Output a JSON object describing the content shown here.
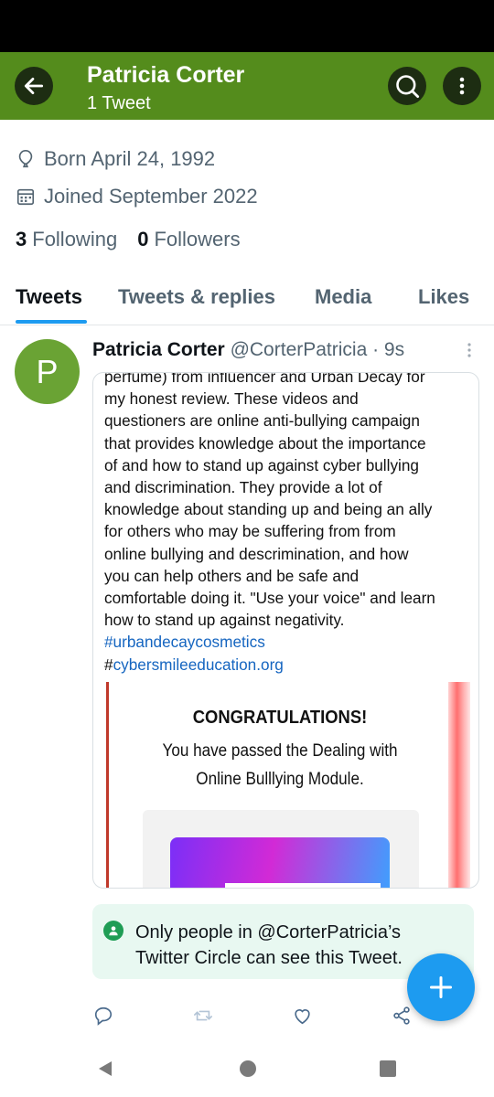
{
  "header": {
    "title": "Patricia Corter",
    "subtitle": "1 Tweet",
    "back_icon": "arrow-left-icon",
    "search_icon": "search-icon",
    "more_icon": "more-vertical-icon"
  },
  "profile": {
    "born": "Born April 24, 1992",
    "joined": "Joined September 2022",
    "following_count": "3",
    "following_label": "Following",
    "followers_count": "0",
    "followers_label": "Followers"
  },
  "tabs": [
    {
      "label": "Tweets",
      "active": true
    },
    {
      "label": "Tweets & replies",
      "active": false
    },
    {
      "label": "Media",
      "active": false
    },
    {
      "label": "Likes",
      "active": false
    }
  ],
  "tweet": {
    "avatar_letter": "P",
    "author_name": "Patricia Corter",
    "author_handle": "@CorterPatricia",
    "time": "· 9s",
    "text_lines": [
      "perfume) from influencer and Urban Decay for",
      "my honest review. These videos and",
      "questioners are online anti-bullying campaign",
      "that provides knowledge about the importance",
      "of and how to stand up against cyber bullying",
      "and discrimination. They provide a lot of",
      "knowledge about standing up and being an ally",
      "for others who may be suffering from from",
      "online bullying and descrimination, and how",
      "you can help others and be safe and",
      "comfortable doing it. \"Use your voice\" and learn",
      "how to stand up against negativity."
    ],
    "hashtag1": "#urbandecaycosmetics",
    "hashtag2_prefix": "#",
    "hashtag2_link": "cybersmileeducation.org",
    "image": {
      "title": "CONGRATULATIONS!",
      "line1": "You have passed the Dealing with",
      "line2": "Online Bulllying Module."
    },
    "circle_notice_line1": "Only people in @CorterPatricia’s",
    "circle_notice_line2": "Twitter Circle can see this Tweet."
  },
  "actions": [
    "reply-icon",
    "retweet-icon",
    "like-icon",
    "share-icon"
  ],
  "colors": {
    "appbar": "#548c1c",
    "accent": "#1d9bf0",
    "avatar": "#6aa334",
    "circle_banner": "#e8f8f1"
  }
}
